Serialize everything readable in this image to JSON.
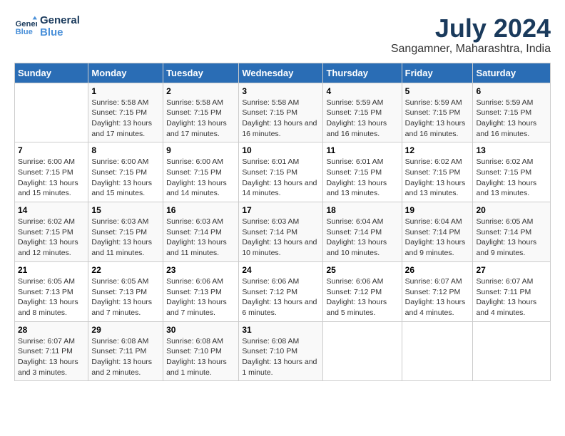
{
  "logo": {
    "line1": "General",
    "line2": "Blue"
  },
  "title": "July 2024",
  "subtitle": "Sangamner, Maharashtra, India",
  "days_of_week": [
    "Sunday",
    "Monday",
    "Tuesday",
    "Wednesday",
    "Thursday",
    "Friday",
    "Saturday"
  ],
  "weeks": [
    [
      {
        "num": "",
        "sunrise": "",
        "sunset": "",
        "daylight": ""
      },
      {
        "num": "1",
        "sunrise": "Sunrise: 5:58 AM",
        "sunset": "Sunset: 7:15 PM",
        "daylight": "Daylight: 13 hours and 17 minutes."
      },
      {
        "num": "2",
        "sunrise": "Sunrise: 5:58 AM",
        "sunset": "Sunset: 7:15 PM",
        "daylight": "Daylight: 13 hours and 17 minutes."
      },
      {
        "num": "3",
        "sunrise": "Sunrise: 5:58 AM",
        "sunset": "Sunset: 7:15 PM",
        "daylight": "Daylight: 13 hours and 16 minutes."
      },
      {
        "num": "4",
        "sunrise": "Sunrise: 5:59 AM",
        "sunset": "Sunset: 7:15 PM",
        "daylight": "Daylight: 13 hours and 16 minutes."
      },
      {
        "num": "5",
        "sunrise": "Sunrise: 5:59 AM",
        "sunset": "Sunset: 7:15 PM",
        "daylight": "Daylight: 13 hours and 16 minutes."
      },
      {
        "num": "6",
        "sunrise": "Sunrise: 5:59 AM",
        "sunset": "Sunset: 7:15 PM",
        "daylight": "Daylight: 13 hours and 16 minutes."
      }
    ],
    [
      {
        "num": "7",
        "sunrise": "Sunrise: 6:00 AM",
        "sunset": "Sunset: 7:15 PM",
        "daylight": "Daylight: 13 hours and 15 minutes."
      },
      {
        "num": "8",
        "sunrise": "Sunrise: 6:00 AM",
        "sunset": "Sunset: 7:15 PM",
        "daylight": "Daylight: 13 hours and 15 minutes."
      },
      {
        "num": "9",
        "sunrise": "Sunrise: 6:00 AM",
        "sunset": "Sunset: 7:15 PM",
        "daylight": "Daylight: 13 hours and 14 minutes."
      },
      {
        "num": "10",
        "sunrise": "Sunrise: 6:01 AM",
        "sunset": "Sunset: 7:15 PM",
        "daylight": "Daylight: 13 hours and 14 minutes."
      },
      {
        "num": "11",
        "sunrise": "Sunrise: 6:01 AM",
        "sunset": "Sunset: 7:15 PM",
        "daylight": "Daylight: 13 hours and 13 minutes."
      },
      {
        "num": "12",
        "sunrise": "Sunrise: 6:02 AM",
        "sunset": "Sunset: 7:15 PM",
        "daylight": "Daylight: 13 hours and 13 minutes."
      },
      {
        "num": "13",
        "sunrise": "Sunrise: 6:02 AM",
        "sunset": "Sunset: 7:15 PM",
        "daylight": "Daylight: 13 hours and 13 minutes."
      }
    ],
    [
      {
        "num": "14",
        "sunrise": "Sunrise: 6:02 AM",
        "sunset": "Sunset: 7:15 PM",
        "daylight": "Daylight: 13 hours and 12 minutes."
      },
      {
        "num": "15",
        "sunrise": "Sunrise: 6:03 AM",
        "sunset": "Sunset: 7:15 PM",
        "daylight": "Daylight: 13 hours and 11 minutes."
      },
      {
        "num": "16",
        "sunrise": "Sunrise: 6:03 AM",
        "sunset": "Sunset: 7:14 PM",
        "daylight": "Daylight: 13 hours and 11 minutes."
      },
      {
        "num": "17",
        "sunrise": "Sunrise: 6:03 AM",
        "sunset": "Sunset: 7:14 PM",
        "daylight": "Daylight: 13 hours and 10 minutes."
      },
      {
        "num": "18",
        "sunrise": "Sunrise: 6:04 AM",
        "sunset": "Sunset: 7:14 PM",
        "daylight": "Daylight: 13 hours and 10 minutes."
      },
      {
        "num": "19",
        "sunrise": "Sunrise: 6:04 AM",
        "sunset": "Sunset: 7:14 PM",
        "daylight": "Daylight: 13 hours and 9 minutes."
      },
      {
        "num": "20",
        "sunrise": "Sunrise: 6:05 AM",
        "sunset": "Sunset: 7:14 PM",
        "daylight": "Daylight: 13 hours and 9 minutes."
      }
    ],
    [
      {
        "num": "21",
        "sunrise": "Sunrise: 6:05 AM",
        "sunset": "Sunset: 7:13 PM",
        "daylight": "Daylight: 13 hours and 8 minutes."
      },
      {
        "num": "22",
        "sunrise": "Sunrise: 6:05 AM",
        "sunset": "Sunset: 7:13 PM",
        "daylight": "Daylight: 13 hours and 7 minutes."
      },
      {
        "num": "23",
        "sunrise": "Sunrise: 6:06 AM",
        "sunset": "Sunset: 7:13 PM",
        "daylight": "Daylight: 13 hours and 7 minutes."
      },
      {
        "num": "24",
        "sunrise": "Sunrise: 6:06 AM",
        "sunset": "Sunset: 7:12 PM",
        "daylight": "Daylight: 13 hours and 6 minutes."
      },
      {
        "num": "25",
        "sunrise": "Sunrise: 6:06 AM",
        "sunset": "Sunset: 7:12 PM",
        "daylight": "Daylight: 13 hours and 5 minutes."
      },
      {
        "num": "26",
        "sunrise": "Sunrise: 6:07 AM",
        "sunset": "Sunset: 7:12 PM",
        "daylight": "Daylight: 13 hours and 4 minutes."
      },
      {
        "num": "27",
        "sunrise": "Sunrise: 6:07 AM",
        "sunset": "Sunset: 7:11 PM",
        "daylight": "Daylight: 13 hours and 4 minutes."
      }
    ],
    [
      {
        "num": "28",
        "sunrise": "Sunrise: 6:07 AM",
        "sunset": "Sunset: 7:11 PM",
        "daylight": "Daylight: 13 hours and 3 minutes."
      },
      {
        "num": "29",
        "sunrise": "Sunrise: 6:08 AM",
        "sunset": "Sunset: 7:11 PM",
        "daylight": "Daylight: 13 hours and 2 minutes."
      },
      {
        "num": "30",
        "sunrise": "Sunrise: 6:08 AM",
        "sunset": "Sunset: 7:10 PM",
        "daylight": "Daylight: 13 hours and 1 minute."
      },
      {
        "num": "31",
        "sunrise": "Sunrise: 6:08 AM",
        "sunset": "Sunset: 7:10 PM",
        "daylight": "Daylight: 13 hours and 1 minute."
      },
      {
        "num": "",
        "sunrise": "",
        "sunset": "",
        "daylight": ""
      },
      {
        "num": "",
        "sunrise": "",
        "sunset": "",
        "daylight": ""
      },
      {
        "num": "",
        "sunrise": "",
        "sunset": "",
        "daylight": ""
      }
    ]
  ]
}
